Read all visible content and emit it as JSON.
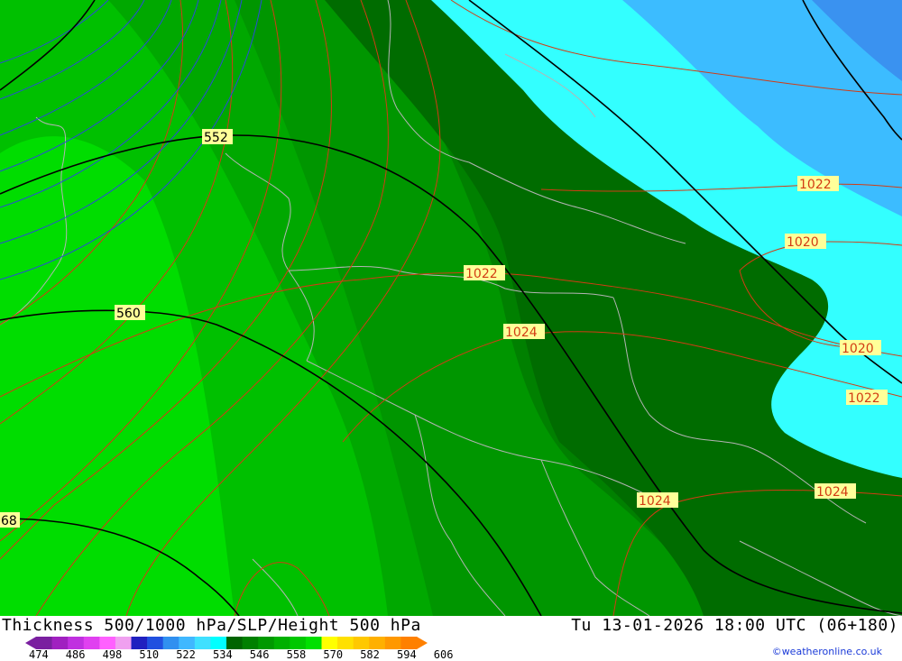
{
  "title_left": "Thickness 500/1000 hPa/SLP/Height 500 hPa",
  "title_right": "Tu 13-01-2026 18:00 UTC (06+180)",
  "credit": "©weatheronline.co.uk",
  "legend": {
    "ticks": [
      "474",
      "486",
      "498",
      "510",
      "522",
      "534",
      "546",
      "558",
      "570",
      "582",
      "594",
      "606"
    ],
    "colors": [
      "#7a1fa0",
      "#a020c0",
      "#c030e0",
      "#e040f0",
      "#ff60ff",
      "#f0a0f0",
      "#2020c0",
      "#2050e0",
      "#3090f0",
      "#40b8ff",
      "#40e0ff",
      "#00ffff",
      "#006400",
      "#008000",
      "#009900",
      "#00b000",
      "#00c800",
      "#00e000",
      "#ffff00",
      "#ffe000",
      "#ffc800",
      "#ffb000",
      "#ff9800",
      "#ff8000"
    ]
  },
  "map_labels": {
    "slp": [
      "1022",
      "1020",
      "1022",
      "1024",
      "1020",
      "1022",
      "1024",
      "1024"
    ],
    "height": [
      "552",
      "560",
      "68"
    ]
  },
  "colors": {
    "sea_cyan": "#33ffff",
    "sea_blue": "#3cbcff",
    "green_dark": "#006e00",
    "green_mid": "#008c00",
    "green_bright": "#00c000",
    "green_lime": "#00ff00",
    "slp_line": "#d23c14",
    "height_line": "#000000",
    "border_line": "#b4b4b4"
  }
}
